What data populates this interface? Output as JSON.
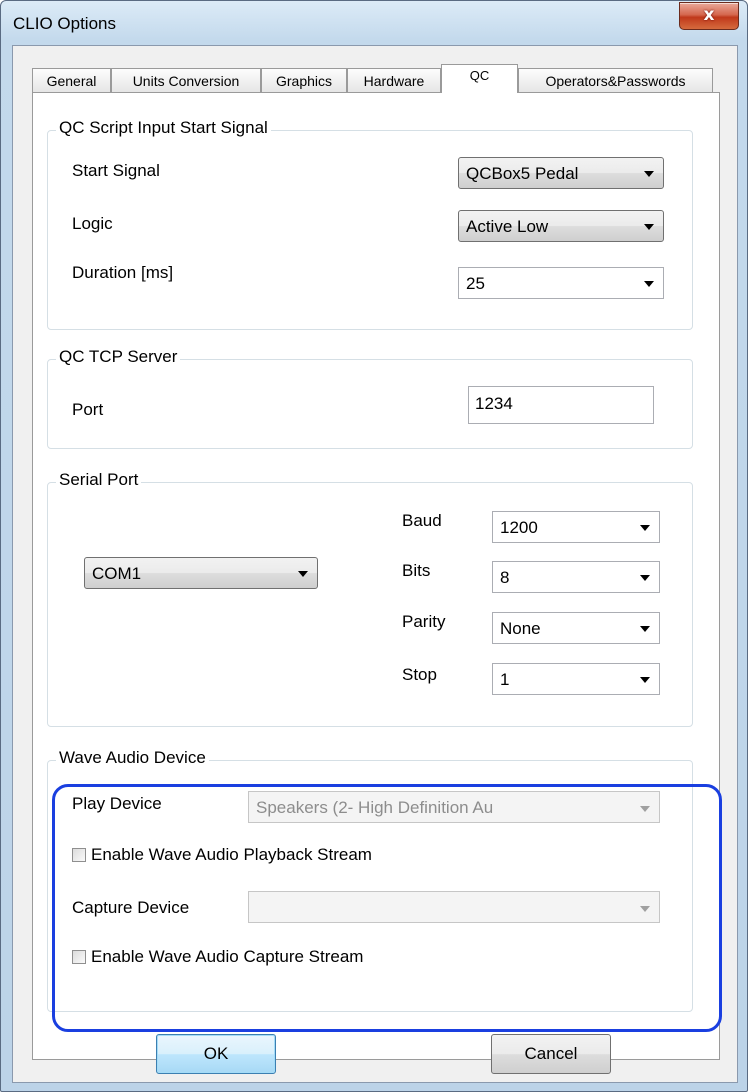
{
  "window": {
    "title": "CLIO Options",
    "close_label": "x"
  },
  "tabs": [
    {
      "label": "General",
      "active": false
    },
    {
      "label": "Units Conversion",
      "active": false
    },
    {
      "label": "Graphics",
      "active": false
    },
    {
      "label": "Hardware",
      "active": false
    },
    {
      "label": "QC",
      "active": true
    },
    {
      "label": "Operators&Passwords",
      "active": false
    }
  ],
  "qc_script": {
    "legend": "QC Script Input Start Signal",
    "start_signal": {
      "label": "Start Signal",
      "value": "QCBox5 Pedal"
    },
    "logic": {
      "label": "Logic",
      "value": "Active Low"
    },
    "duration": {
      "label": "Duration [ms]",
      "value": "25"
    }
  },
  "tcp_server": {
    "legend": "QC TCP Server",
    "port_label": "Port",
    "port_value": "1234"
  },
  "serial_port": {
    "legend": "Serial Port",
    "port_value": "COM1",
    "baud": {
      "label": "Baud",
      "value": "1200"
    },
    "bits": {
      "label": "Bits",
      "value": "8"
    },
    "parity": {
      "label": "Parity",
      "value": "None"
    },
    "stop": {
      "label": "Stop",
      "value": "1"
    }
  },
  "wave_audio": {
    "legend": "Wave Audio Device",
    "play_device": {
      "label": "Play Device",
      "value": "Speakers (2- High Definition Au"
    },
    "playback_stream": {
      "label": "Enable Wave Audio Playback Stream",
      "checked": false
    },
    "capture_device": {
      "label": "Capture Device",
      "value": ""
    },
    "capture_stream": {
      "label": "Enable Wave Audio Capture Stream",
      "checked": false
    }
  },
  "buttons": {
    "ok": "OK",
    "cancel": "Cancel"
  },
  "colors": {
    "highlight": "#1a3fe0",
    "close_button": "#c0391b"
  }
}
